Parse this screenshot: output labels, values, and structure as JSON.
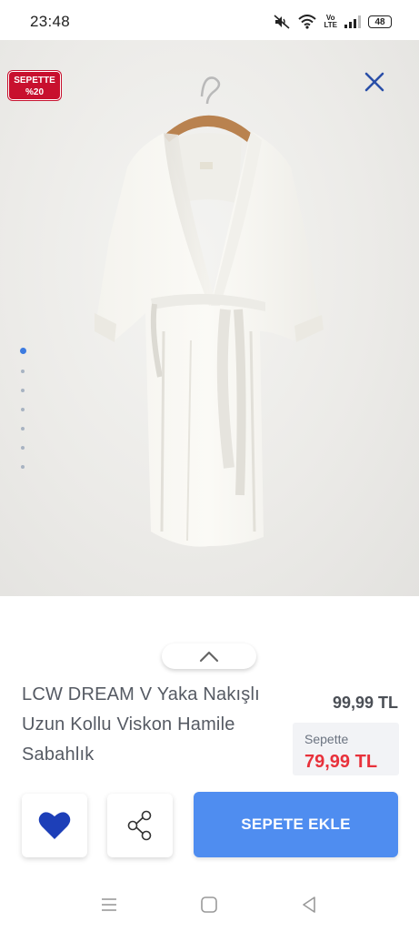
{
  "status_bar": {
    "time": "23:48",
    "volte": [
      "Vo",
      "LTE"
    ],
    "battery": "48",
    "icons": [
      "mute-icon",
      "wifi-icon",
      "volte-icon",
      "signal-icon",
      "battery-icon"
    ]
  },
  "hero": {
    "promo_badge": {
      "line1": "SEPETTE",
      "line2": "%20"
    },
    "gallery": {
      "count": 7,
      "active_index": 0
    },
    "close_icon": "close-icon"
  },
  "product": {
    "title": "LCW DREAM V Yaka Nakışlı Uzun Kollu Viskon Hamile Sabahlık",
    "price": "99,99 TL",
    "cart_price_label": "Sepette",
    "cart_price": "79,99 TL"
  },
  "actions": {
    "cart_button_label": "SEPETE EKLE",
    "favorite_icon": "heart-icon",
    "share_icon": "share-icon",
    "expand_icon": "chevron-up-icon"
  },
  "navigation": {
    "buttons": [
      "menu-icon",
      "home-icon",
      "back-icon"
    ]
  },
  "colors": {
    "accent_blue": "#4f8df0",
    "heart_blue": "#1d3fb8",
    "sale_red": "#e8313b",
    "badge_red": "#c8102e",
    "close_blue": "#2a4fa8"
  }
}
